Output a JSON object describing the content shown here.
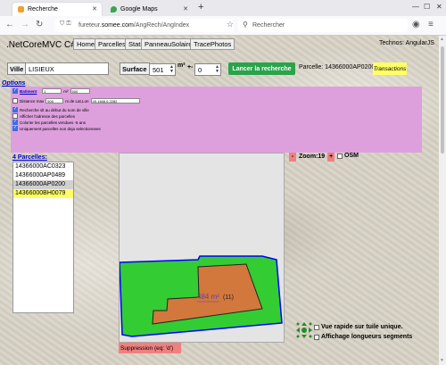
{
  "browser": {
    "tabs": [
      {
        "title": "Recherche",
        "color": "#f0a030"
      },
      {
        "title": "Google Maps",
        "color": "#34a853"
      }
    ],
    "url_prefix": "fureteur.",
    "url_domain": "somee.com",
    "url_path": "/AngRech/AngIndex",
    "search_placeholder": "Rechercher"
  },
  "header": {
    "brand": ".NetCoreMVC C#",
    "nav": [
      "Home",
      "Parcelles",
      "Stats",
      "PanneauSolaire",
      "TracePhotos"
    ],
    "technos": "Technos: AngularJS"
  },
  "search": {
    "ville_label": "Ville",
    "ville_value": "LISIEUX",
    "surface_label": "Surface",
    "surface_value": "501",
    "m2": "m²",
    "plusminus": "+-",
    "tolerance_value": "0",
    "submit_label": "Lancer la recherche",
    "parcelle_text": "Parcelle: 14366000AP0200",
    "transactions_label": "Transactions"
  },
  "options": {
    "title": "Options",
    "batiment_label": "Batiment",
    "batiment_min": "1",
    "batiment_unit": "m²",
    "batiment_max": "500",
    "distance_label": "Distance max",
    "distance_value": "500",
    "distance_from": "m de Lat,Lon",
    "latlon": "49.1468,0.2282",
    "opt_rows": [
      "Recherche slt au début du nom de ville",
      "Afficher l'adresse des parcelles",
      "Colorier les parcelles vendues -5 ans",
      "Uniquement parcelles non deja selectionnees"
    ]
  },
  "parcels": {
    "title": "4 Parcelles:",
    "items": [
      "14366000AC0323",
      "14366000AP0489",
      "14366000AP0200",
      "14366000BH0079"
    ],
    "selected_index": 2,
    "highlight_index": 3
  },
  "map": {
    "area_label": "484 m²",
    "count_label": "(11)",
    "green": "#33cc33",
    "orange": "#d2783c",
    "outline": "#0000ff"
  },
  "controls": {
    "delete_label": "Suppression (eq: 'd')",
    "zoom_minus": "-",
    "zoom_label": "Zoom:19",
    "zoom_plus": "+",
    "osm_label": "OSM",
    "tile_label": "Vue rapide sur tuile unique.",
    "segments_label": "Affichage longueurs segments"
  }
}
